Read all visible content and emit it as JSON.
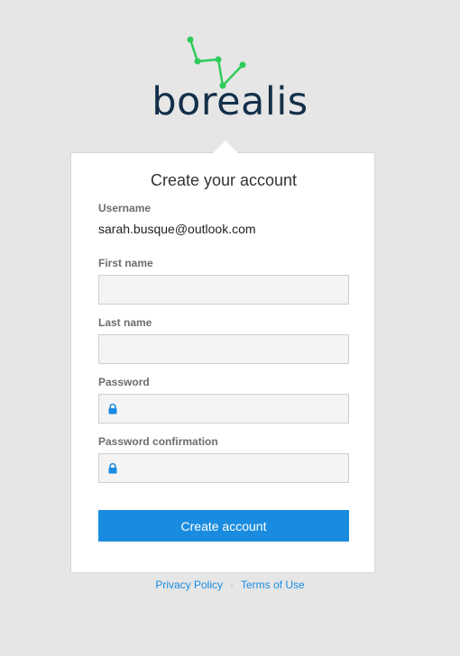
{
  "brand": {
    "name": "borealis",
    "logo_icon": "constellation-icon",
    "text_color": "#14304a",
    "accent_color": "#2ecc5a"
  },
  "form": {
    "title": "Create your account",
    "username": {
      "label": "Username",
      "value": "sarah.busque@outlook.com"
    },
    "first_name": {
      "label": "First name",
      "value": ""
    },
    "last_name": {
      "label": "Last name",
      "value": ""
    },
    "password": {
      "label": "Password",
      "value": "",
      "icon": "lock-icon"
    },
    "password_confirmation": {
      "label": "Password confirmation",
      "value": "",
      "icon": "lock-icon"
    },
    "submit_label": "Create account",
    "button_color": "#1a8ce0"
  },
  "footer": {
    "privacy_label": "Privacy Policy",
    "separator": "·",
    "terms_label": "Terms of Use"
  }
}
